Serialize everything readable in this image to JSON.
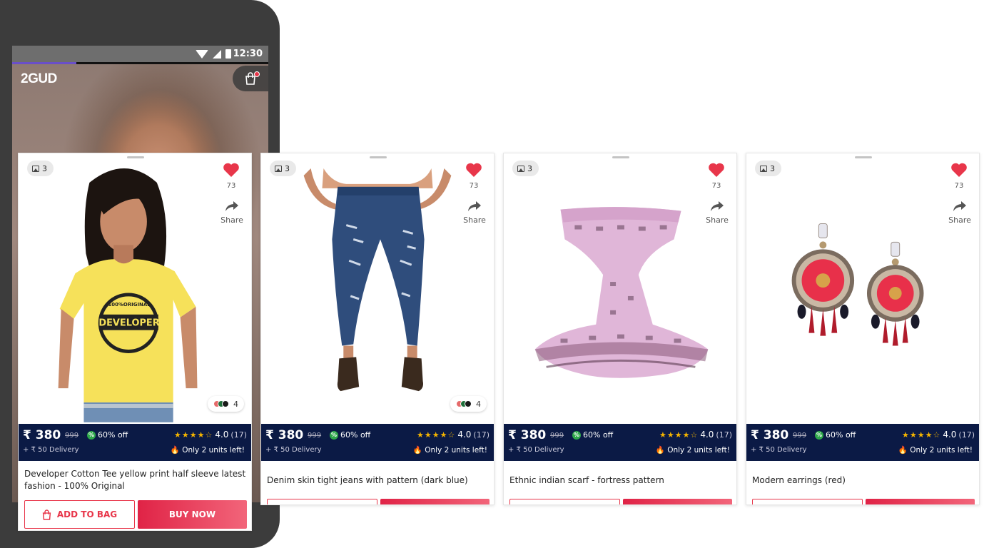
{
  "status_bar": {
    "time": "12:30"
  },
  "app": {
    "logo": "2GUD",
    "cart_badge": "1"
  },
  "colors": {
    "accent": "#e8364a",
    "price_bar": "#0b1a45",
    "discount_badge": "#2ea84a",
    "star": "#f4b400"
  },
  "cards": [
    {
      "image_count": "3",
      "likes": "73",
      "share_label": "Share",
      "variants_count": "4",
      "price": "₹ 380",
      "mrp": "999",
      "discount": "60% off",
      "stars": "★★★★☆",
      "rating": "4.0",
      "reviews": "(17)",
      "delivery": "+ ₹ 50 Delivery",
      "stock": "Only 2 units left!",
      "title": "Developer Cotton Tee yellow print half sleeve latest fashion - 100% Original",
      "add_label": "ADD TO BAG",
      "buy_label": "BUY NOW",
      "tee_print_top": "100%ORIGINAL",
      "tee_print_main": "DEVELOPER"
    },
    {
      "image_count": "3",
      "likes": "73",
      "share_label": "Share",
      "variants_count": "4",
      "price": "₹ 380",
      "mrp": "999",
      "discount": "60% off",
      "stars": "★★★★☆",
      "rating": "4.0",
      "reviews": "(17)",
      "delivery": "+ ₹ 50 Delivery",
      "stock": "Only 2 units left!",
      "title": "Denim skin tight jeans with pattern (dark blue)"
    },
    {
      "image_count": "3",
      "likes": "73",
      "share_label": "Share",
      "price": "₹ 380",
      "mrp": "999",
      "discount": "60% off",
      "stars": "★★★★☆",
      "rating": "4.0",
      "reviews": "(17)",
      "delivery": "+ ₹ 50 Delivery",
      "stock": "Only 2 units left!",
      "title": "Ethnic indian scarf - fortress pattern"
    },
    {
      "image_count": "3",
      "likes": "73",
      "share_label": "Share",
      "price": "₹ 380",
      "mrp": "999",
      "discount": "60% off",
      "stars": "★★★★☆",
      "rating": "4.0",
      "reviews": "(17)",
      "delivery": "+ ₹ 50 Delivery",
      "stock": "Only 2 units left!",
      "title": "Modern earrings (red)"
    }
  ]
}
